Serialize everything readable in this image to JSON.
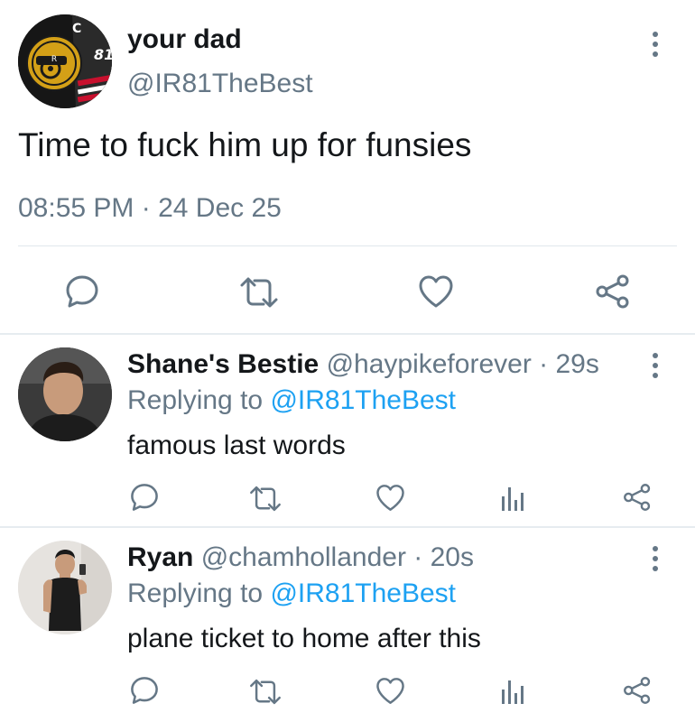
{
  "main_tweet": {
    "author_name": "your dad",
    "author_handle": "@IR81TheBest",
    "text": "Time to fuck him up for funsies",
    "timestamp": "08:55 PM · 24 Dec 25",
    "avatar_number": "81"
  },
  "replies": [
    {
      "author_name": "Shane's Bestie",
      "author_handle": "@haypikeforever",
      "time": "· 29s",
      "replying_label": "Replying to",
      "replying_handle": "@IR81TheBest",
      "text": "famous last words"
    },
    {
      "author_name": "Ryan",
      "author_handle": "@chamhollander",
      "time": "· 20s",
      "replying_label": "Replying to",
      "replying_handle": "@IR81TheBest",
      "text": "plane ticket to home after this"
    }
  ],
  "colors": {
    "text": "#14171a",
    "secondary": "#657786",
    "link": "#1da1f2",
    "divider": "#e1e8ed"
  },
  "icons": [
    "reply-icon",
    "retweet-icon",
    "like-icon",
    "share-icon",
    "analytics-icon",
    "more-icon"
  ]
}
